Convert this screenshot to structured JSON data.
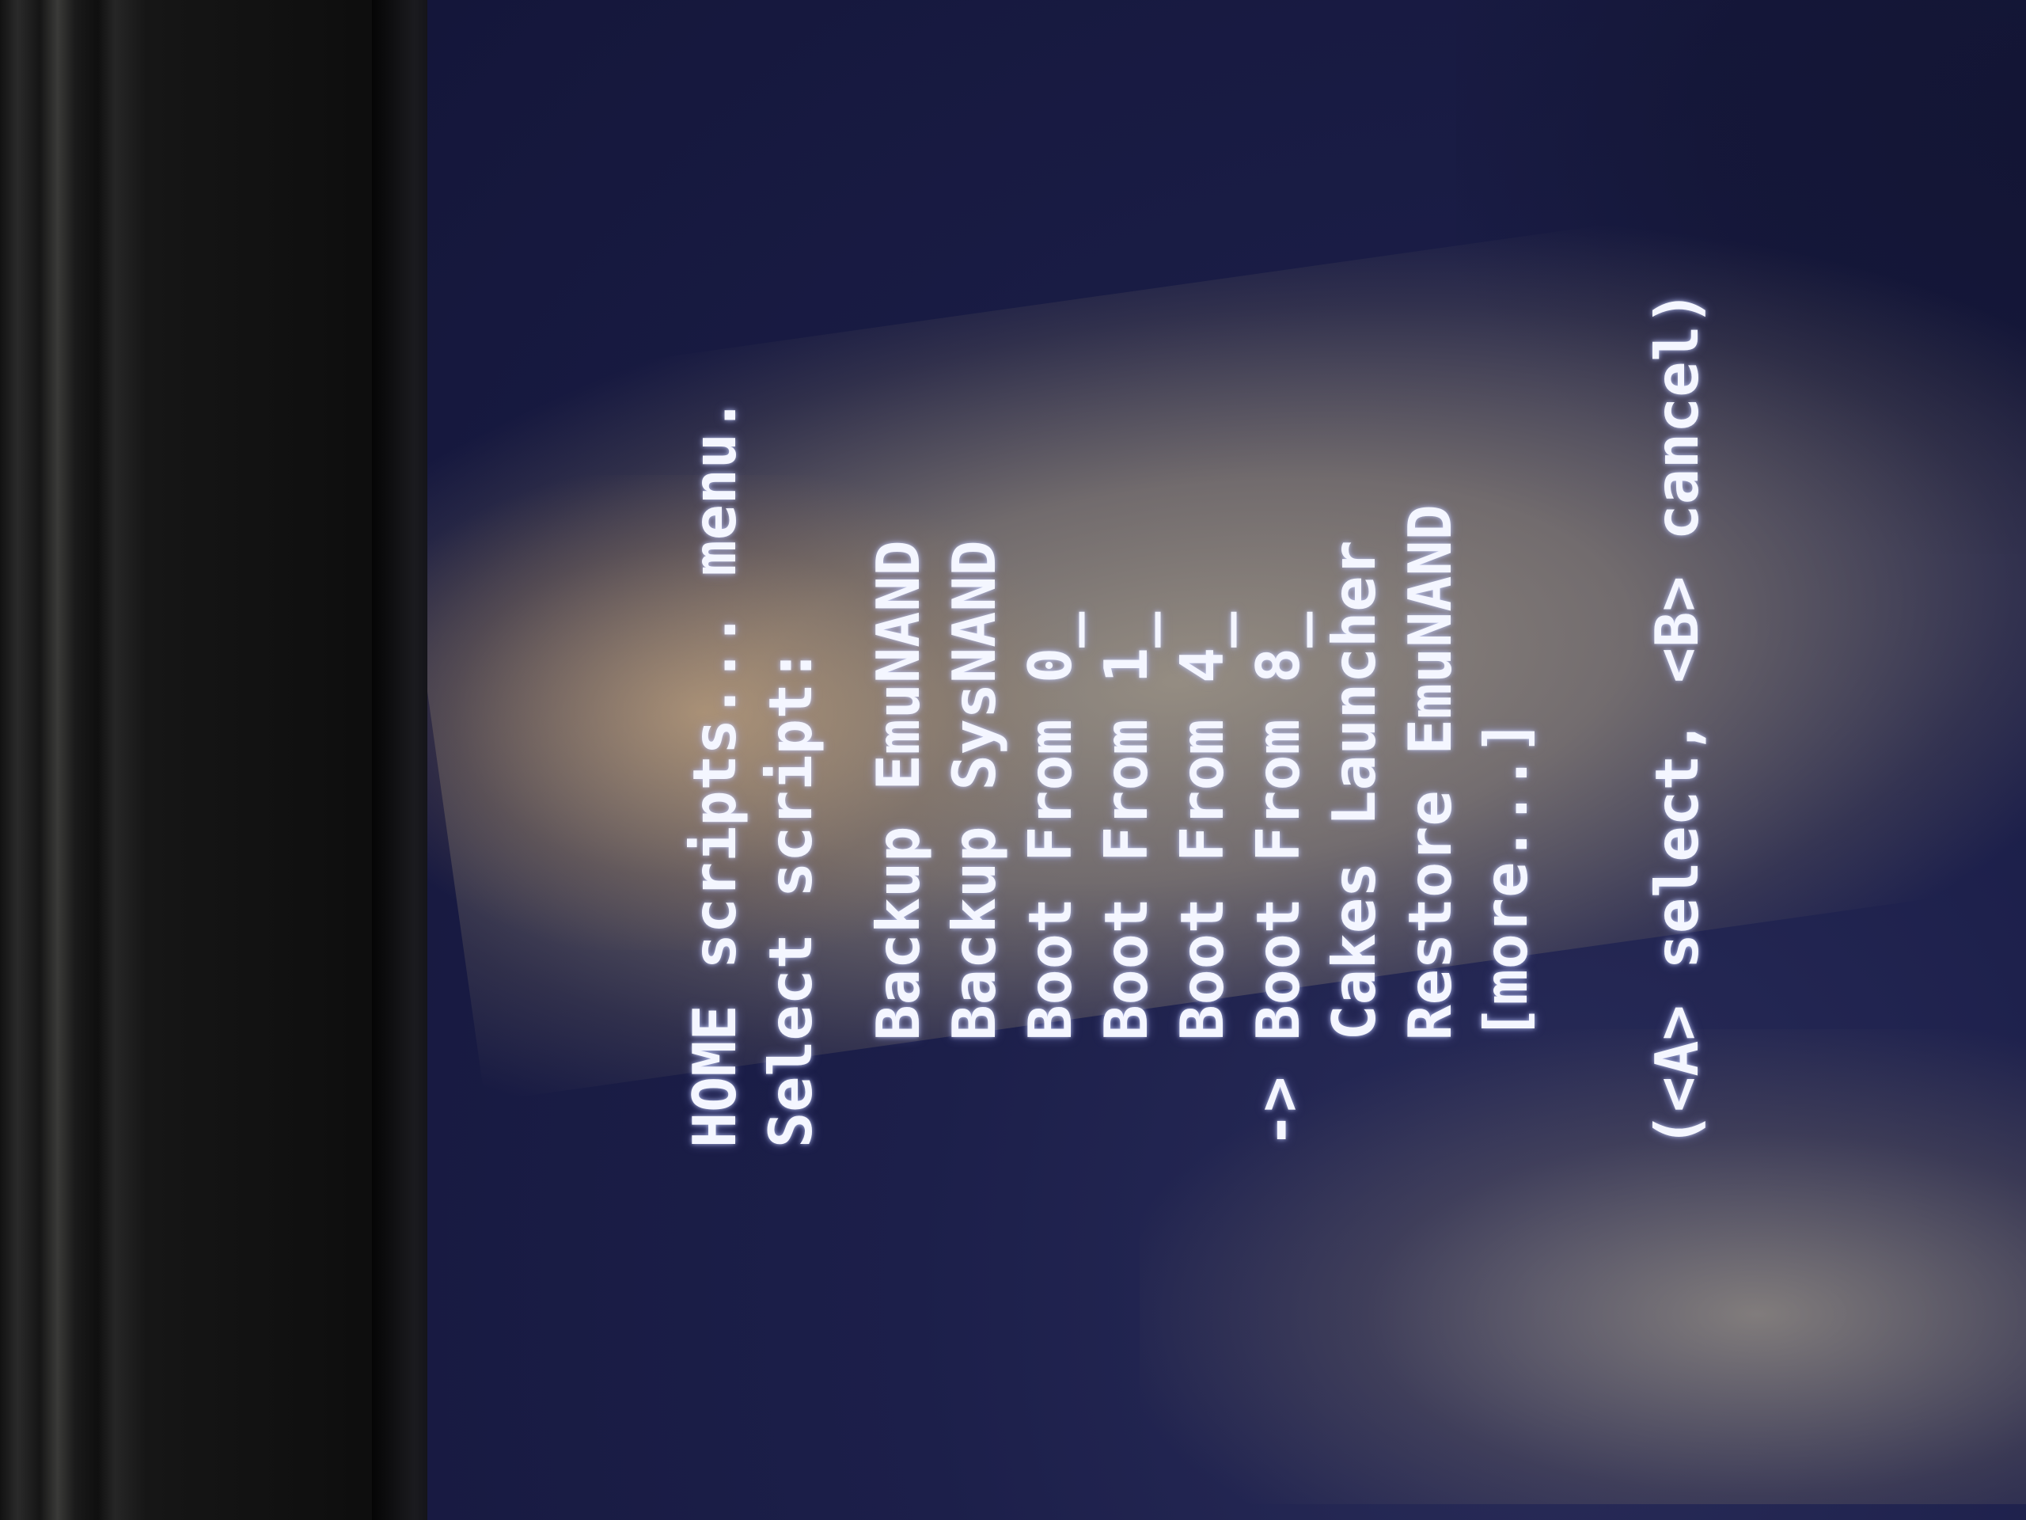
{
  "header": {
    "title": "HOME scripts... menu.",
    "subtitle": "Select script:"
  },
  "menu": {
    "cursor": "->",
    "items": [
      {
        "label": "Backup EmuNAND",
        "selected": false
      },
      {
        "label": "Backup SysNAND",
        "selected": false
      },
      {
        "label": "Boot From 0_",
        "selected": false
      },
      {
        "label": "Boot From 1_",
        "selected": false
      },
      {
        "label": "Boot From 4_",
        "selected": false
      },
      {
        "label": "Boot From 8_",
        "selected": true
      },
      {
        "label": "Cakes Launcher",
        "selected": false
      },
      {
        "label": "Restore EmuNAND",
        "selected": false
      }
    ],
    "more": "[more...]"
  },
  "footer": {
    "hint": "(<A> select, <B> cancel)"
  },
  "colors": {
    "text": "#f4f6ff",
    "screen_bg": "#1c1f4a"
  }
}
